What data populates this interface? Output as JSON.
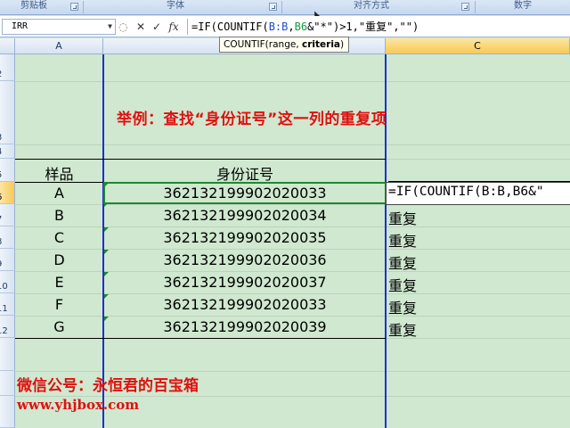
{
  "ribbon": {
    "groups": [
      {
        "label": "剪贴板"
      },
      {
        "label": "字体"
      },
      {
        "label": "对齐方式"
      },
      {
        "label": "数字"
      }
    ]
  },
  "formula_bar": {
    "name_box": "IRR",
    "cancel_symbol": "✕",
    "enter_symbol": "✓",
    "fx_symbol": "fx",
    "formula_prefix": "=IF(COUNTIF(",
    "formula_ref1": "B:B",
    "formula_sep": ",",
    "formula_ref2": "B6",
    "formula_suffix": "&\"*\")>1,\"重复\",\"\")"
  },
  "tooltip": {
    "func": "COUNTIF(range, ",
    "arg_bold": "criteria",
    "close": ")"
  },
  "columns": [
    "A",
    "",
    "C"
  ],
  "rows": [
    "2",
    "3",
    "4",
    "5",
    "6",
    "7",
    "8",
    "9",
    "10",
    "11",
    "12",
    "",
    "",
    ""
  ],
  "sheet": {
    "heading": "举例：查找“身份证号”这一列的重复项",
    "header_sample": "样品",
    "header_id": "身份证号",
    "records": [
      {
        "sample": "A",
        "id": "362132199902020033",
        "result": ""
      },
      {
        "sample": "B",
        "id": "362132199902020034",
        "result": "重复"
      },
      {
        "sample": "C",
        "id": "362132199902020035",
        "result": "重复"
      },
      {
        "sample": "D",
        "id": "362132199902020036",
        "result": "重复"
      },
      {
        "sample": "E",
        "id": "362132199902020037",
        "result": "重复"
      },
      {
        "sample": "F",
        "id": "362132199902020033",
        "result": "重复"
      },
      {
        "sample": "G",
        "id": "362132199902020039",
        "result": "重复"
      }
    ],
    "editing_text": "=IF(COUNTIF(B:B,B6&\"",
    "footer_wechat": "微信公号：永恒君的百宝箱",
    "footer_url": "www.yhjbox.com"
  },
  "colors": {
    "accent_red": "#e01010",
    "trace_blue": "#1b2fd6",
    "active_green": "#1c8a2e"
  }
}
